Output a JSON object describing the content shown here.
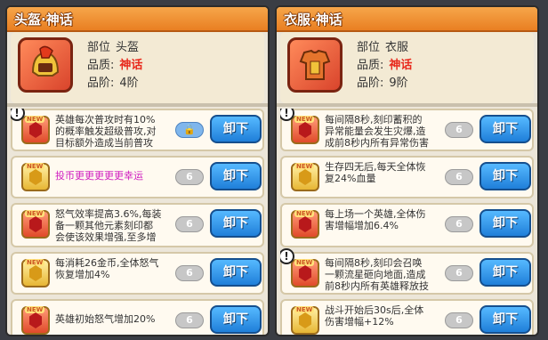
{
  "panels": [
    {
      "title": "头盔·神话",
      "info": {
        "slot_label": "部位",
        "slot_value": "头盔",
        "quality_label": "品质:",
        "quality_value": "神话",
        "tier_label": "品阶:",
        "tier_value": "4阶"
      },
      "portrait_icon": "helmet-icon",
      "items": [
        {
          "desc": "英雄每次普攻时有10%的概率触发超级普攻,对目标额外造成当前普攻伤害",
          "excl": "!",
          "lock": "🔒",
          "button": "卸下",
          "gem": "red",
          "new": "NEW"
        },
        {
          "desc": "投币更更更更更幸运",
          "excl": "",
          "lock": "6",
          "button": "卸下",
          "gem": "gold",
          "new": "NEW"
        },
        {
          "desc": "怒气效率提高3.6%,每装备一颗其他元素刻印都会使该效果增强,至多增强",
          "excl": "",
          "lock": "6",
          "button": "卸下",
          "gem": "red",
          "new": "NEW"
        },
        {
          "desc": "每消耗26金币,全体怒气恢复增加4%",
          "excl": "",
          "lock": "6",
          "button": "卸下",
          "gem": "gold",
          "new": "NEW"
        },
        {
          "desc": "英雄初始怒气增加20%",
          "excl": "",
          "lock": "6",
          "button": "卸下",
          "gem": "red",
          "new": "NEW"
        }
      ]
    },
    {
      "title": "衣服·神话",
      "info": {
        "slot_label": "部位",
        "slot_value": "衣服",
        "quality_label": "品质:",
        "quality_value": "神话",
        "tier_label": "品阶:",
        "tier_value": "9阶"
      },
      "portrait_icon": "armor-icon",
      "items": [
        {
          "desc": "每间隔8秒,刻印蓄积的异常能量会发生灾爆,造成前8秒内所有异常伤害",
          "excl": "!",
          "lock": "6",
          "button": "卸下",
          "gem": "red",
          "new": "NEW"
        },
        {
          "desc": "生存四无后,每天全体恢复24%血量",
          "excl": "",
          "lock": "6",
          "button": "卸下",
          "gem": "gold",
          "new": "NEW"
        },
        {
          "desc": "每上场一个英雄,全体伤害增幅增加6.4%",
          "excl": "",
          "lock": "6",
          "button": "卸下",
          "gem": "red",
          "new": "NEW"
        },
        {
          "desc": "每间隔8秒,刻印会召唤一颗流星砸向地面,造成前8秒内所有英雄释放技",
          "excl": "!",
          "lock": "6",
          "button": "卸下",
          "gem": "red",
          "new": "NEW"
        },
        {
          "desc": "战斗开始后30s后,全体伤害增幅+12%",
          "excl": "",
          "lock": "6",
          "button": "卸下",
          "gem": "gold",
          "new": "NEW"
        }
      ]
    }
  ]
}
